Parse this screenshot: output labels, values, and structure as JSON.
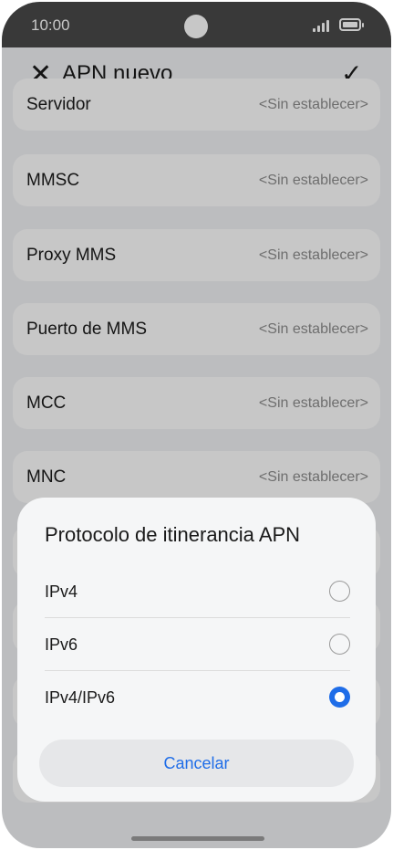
{
  "status_bar": {
    "time": "10:00"
  },
  "header": {
    "title": "APN nuevo",
    "close_icon": "close-icon",
    "confirm_icon": "check-icon"
  },
  "rows": [
    {
      "label": "Servidor",
      "value": "<Sin establecer>"
    },
    {
      "label": "MMSC",
      "value": "<Sin establecer>"
    },
    {
      "label": "Proxy MMS",
      "value": "<Sin establecer>"
    },
    {
      "label": "Puerto de MMS",
      "value": "<Sin establecer>"
    },
    {
      "label": "MCC",
      "value": "<Sin establecer>"
    },
    {
      "label": "MNC",
      "value": "<Sin establecer>"
    }
  ],
  "dialog": {
    "title": "Protocolo de itinerancia APN",
    "options": [
      {
        "label": "IPv4",
        "selected": false
      },
      {
        "label": "IPv6",
        "selected": false
      },
      {
        "label": "IPv4/IPv6",
        "selected": true
      }
    ],
    "cancel_label": "Cancelar"
  },
  "colors": {
    "accent": "#1f6de8",
    "status_bar": "#4a4a4a"
  }
}
